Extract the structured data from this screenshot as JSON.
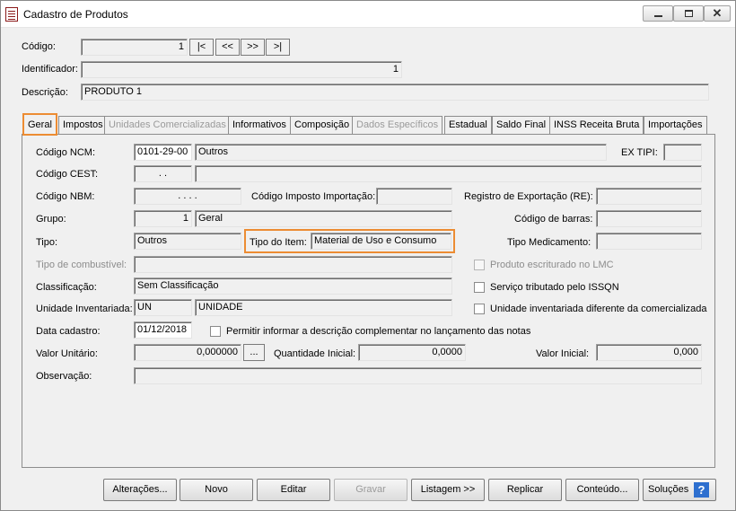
{
  "window": {
    "title": "Cadastro de Produtos",
    "minimize": "",
    "maximize": "",
    "close": "✕"
  },
  "header": {
    "codigo_label": "Código:",
    "codigo_value": "1",
    "nav_first": "|<",
    "nav_prev": "<<",
    "nav_next": ">>",
    "nav_last": ">|",
    "identificador_label": "Identificador:",
    "identificador_value": "1",
    "descricao_label": "Descrição:",
    "descricao_value": "PRODUTO 1"
  },
  "tabs": [
    {
      "label": "Geral",
      "active": true,
      "enabled": true
    },
    {
      "label": "Impostos",
      "active": false,
      "enabled": true
    },
    {
      "label": "Unidades Comercializadas",
      "active": false,
      "enabled": false
    },
    {
      "label": "Informativos",
      "active": false,
      "enabled": true
    },
    {
      "label": "Composição",
      "active": false,
      "enabled": true
    },
    {
      "label": "Dados Específicos",
      "active": false,
      "enabled": false
    },
    {
      "label": "Estadual",
      "active": false,
      "enabled": true
    },
    {
      "label": "Saldo Final",
      "active": false,
      "enabled": true
    },
    {
      "label": "INSS Receita Bruta",
      "active": false,
      "enabled": true
    },
    {
      "label": "Importações",
      "active": false,
      "enabled": true
    }
  ],
  "geral": {
    "ncm_label": "Código NCM:",
    "ncm_code": "0101-29-00",
    "ncm_desc": "Outros",
    "ex_tipi_label": "EX TIPI:",
    "ex_tipi_value": "",
    "cest_label": "Código CEST:",
    "cest_code": ".  .",
    "cest_desc": "",
    "nbm_label": "Código NBM:",
    "nbm_code": ".  .  .  .",
    "imposto_importacao_label": "Código Imposto Importação:",
    "imposto_importacao_value": "",
    "registro_exportacao_label": "Registro de Exportação (RE):",
    "registro_exportacao_value": "",
    "grupo_label": "Grupo:",
    "grupo_code": "1",
    "grupo_desc": "Geral",
    "codigo_barras_label": "Código de barras:",
    "codigo_barras_value": "",
    "tipo_label": "Tipo:",
    "tipo_value": "Outros",
    "tipo_item_label": "Tipo do Item:",
    "tipo_item_value": "Material de Uso e Consumo",
    "tipo_medicamento_label": "Tipo Medicamento:",
    "tipo_medicamento_value": "",
    "tipo_combustivel_label": "Tipo de combustível:",
    "tipo_combustivel_value": "",
    "lmc_label": "Produto escriturado no LMC",
    "classificacao_label": "Classificação:",
    "classificacao_value": "Sem Classificação",
    "issqn_label": "Serviço tributado pelo ISSQN",
    "unidade_label": "Unidade Inventariada:",
    "unidade_code": "UN",
    "unidade_desc": "UNIDADE",
    "unidade_diferente_label": "Unidade inventariada diferente da comercializada",
    "data_cadastro_label": "Data cadastro:",
    "data_cadastro_value": "01/12/2018",
    "descricao_complementar_label": "Permitir informar a descrição complementar no lançamento das notas",
    "valor_unitario_label": "Valor Unitário:",
    "valor_unitario_value": "0,000000",
    "ellipsis": "...",
    "quantidade_inicial_label": "Quantidade Inicial:",
    "quantidade_inicial_value": "0,0000",
    "valor_inicial_label": "Valor Inicial:",
    "valor_inicial_value": "0,000",
    "observacao_label": "Observação:",
    "observacao_value": ""
  },
  "buttons": {
    "alteracoes": "Alterações...",
    "novo": "Novo",
    "editar": "Editar",
    "gravar": "Gravar",
    "listagem": "Listagem >>",
    "replicar": "Replicar",
    "conteudo": "Conteúdo...",
    "solucoes": "Soluções",
    "help": "?"
  },
  "colors": {
    "highlight": "#ec8c33",
    "help_icon": "#2d6fcf"
  }
}
